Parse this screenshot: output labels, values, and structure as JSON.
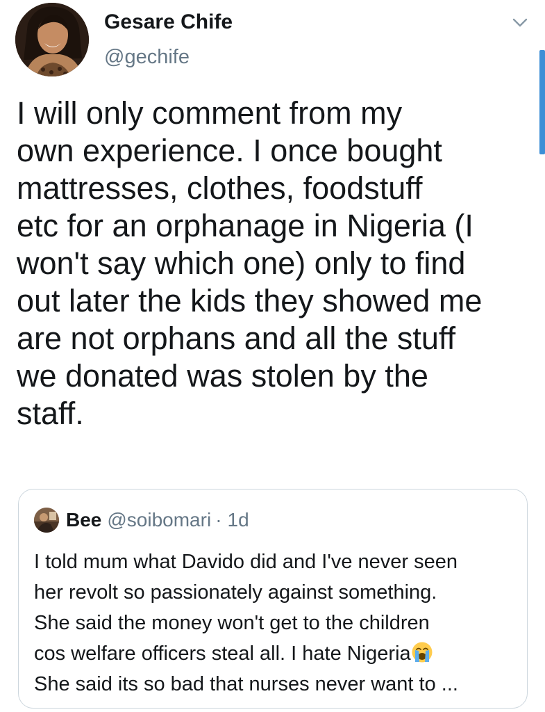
{
  "tweet": {
    "author_name": "Gesare Chife",
    "author_handle": "@gechife",
    "text_lines": [
      "I will only comment from my",
      "own experience.  I once bought",
      "mattresses, clothes, foodstuff",
      "etc for an orphanage in Nigeria (I",
      "won't say which one) only to find",
      "out later the kids they showed me",
      "are not orphans and all the stuff",
      "we donated was stolen by the",
      "staff."
    ]
  },
  "quoted_tweet": {
    "author_name": "Bee",
    "author_handle": "@soibomari",
    "separator": "·",
    "time": "1d",
    "text_lines": [
      "I told mum what Davido did and I've never seen",
      "her revolt so passionately against something.",
      "She said the money won't get to the children",
      "cos welfare officers steal all. I hate Nigeria",
      "She said its so bad that nurses never want to ..."
    ],
    "emoji": "loudly-crying-face"
  },
  "icons": {
    "menu": "chevron-down-icon"
  },
  "colors": {
    "text": "#14171a",
    "secondary": "#657786",
    "border": "#ccd6dd",
    "scrollbar": "#3d8fd6"
  }
}
